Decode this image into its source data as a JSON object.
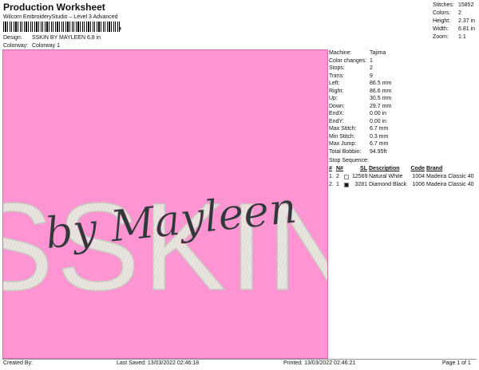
{
  "header": {
    "title": "Production Worksheet",
    "subtitle": "Wilcom EmbroideryStudio – Level 3 Advanced",
    "barcode_suffix": ","
  },
  "design": {
    "design_label": "Design:",
    "design_value": "SSKIN BY MAYLEEN 6,8 in",
    "colorway_label": "Colorway:",
    "colorway_value": "Colorway 1"
  },
  "stats": [
    {
      "k": "Stitches:",
      "v": "15852"
    },
    {
      "k": "Colors:",
      "v": "2"
    },
    {
      "k": "Height:",
      "v": "2.37 in"
    },
    {
      "k": "Width:",
      "v": "6.81 in"
    },
    {
      "k": "Zoom:",
      "v": "1:1"
    }
  ],
  "artwork": {
    "main_text": "SSKIN",
    "script_text": "by Mayleen",
    "colors": {
      "background": "#ff94d3",
      "fill": "#e8e6df",
      "script": "#2e3a38"
    }
  },
  "info": [
    {
      "k": "Machine:",
      "v": "Tajima"
    },
    {
      "k": "Color changes:",
      "v": "1"
    },
    {
      "k": "Stops:",
      "v": "2"
    },
    {
      "k": "Trims:",
      "v": "9"
    },
    {
      "k": "Left:",
      "v": "86.5 mm"
    },
    {
      "k": "Right:",
      "v": "86.6 mm"
    },
    {
      "k": "Up:",
      "v": "30.5 mm"
    },
    {
      "k": "Down:",
      "v": "29.7 mm"
    },
    {
      "k": "EndX:",
      "v": "0.00 in"
    },
    {
      "k": "EndY:",
      "v": "0.00 in"
    },
    {
      "k": "Max Stitch:",
      "v": "6.7 mm"
    },
    {
      "k": "Min Stitch:",
      "v": "0.3 mm"
    },
    {
      "k": "Max Jump:",
      "v": "6.7 mm"
    },
    {
      "k": "Total Bobbin:",
      "v": "94.95ft"
    }
  ],
  "sequence": {
    "title": "Stop Sequence:",
    "headers": [
      "#",
      "N#",
      "",
      "SL",
      "Description",
      "Code",
      "Brand"
    ],
    "rows": [
      {
        "num": "1.",
        "n": "2",
        "swatch": "#f4f4f0",
        "sl": "12569",
        "desc": "Natural White",
        "code": "1004",
        "brand": "Madeira Classic 40"
      },
      {
        "num": "2.",
        "n": "1",
        "swatch": "#1a1a1a",
        "sl": "3281",
        "desc": "Diamond Black",
        "code": "1006",
        "brand": "Madeira Classic 40"
      }
    ]
  },
  "footer": {
    "created": "Created By:",
    "saved": "Last Saved: 13/03/2022 02:46:18",
    "printed": "Printed: 13/03/2022 02:46:21",
    "page": "Page 1 of 1"
  }
}
